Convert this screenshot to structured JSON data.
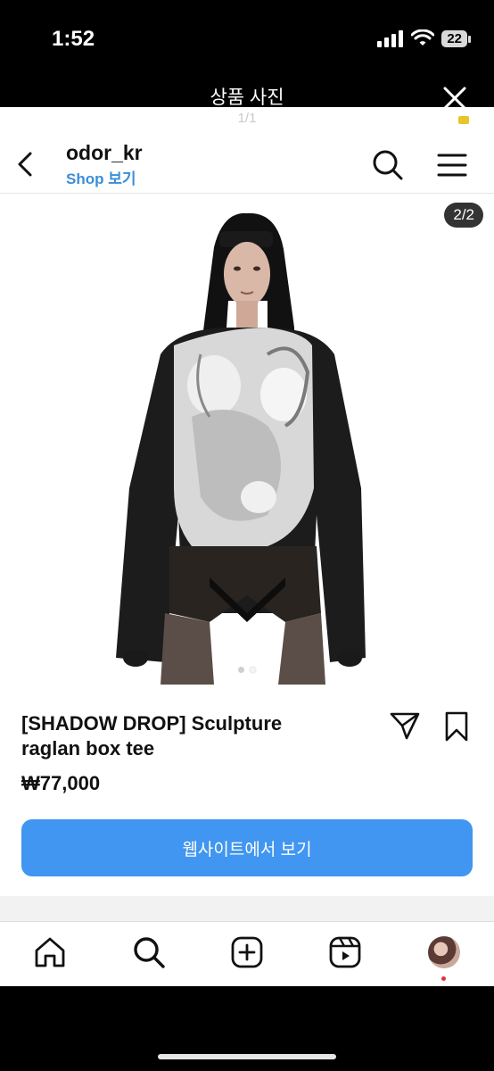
{
  "status_bar": {
    "time": "1:52",
    "battery": "22"
  },
  "viewer": {
    "title": "상품 사진",
    "counter": "1/1"
  },
  "header": {
    "account": "odor_kr",
    "shop_link": "Shop 보기"
  },
  "photo": {
    "page_indicator": "2/2",
    "carousel_pages": 2,
    "active_page": 2
  },
  "product": {
    "title_line1": "[SHADOW DROP] Sculpture",
    "title_line2": "raglan box tee",
    "price": "₩77,000"
  },
  "cta": {
    "label": "웹사이트에서 보기"
  },
  "colors": {
    "accent": "#4096f0",
    "shop_link": "#3b8ed9",
    "notification": "#e0323c"
  },
  "bottom_nav": [
    "home-icon",
    "search-icon",
    "create-icon",
    "reels-icon",
    "profile-avatar"
  ]
}
